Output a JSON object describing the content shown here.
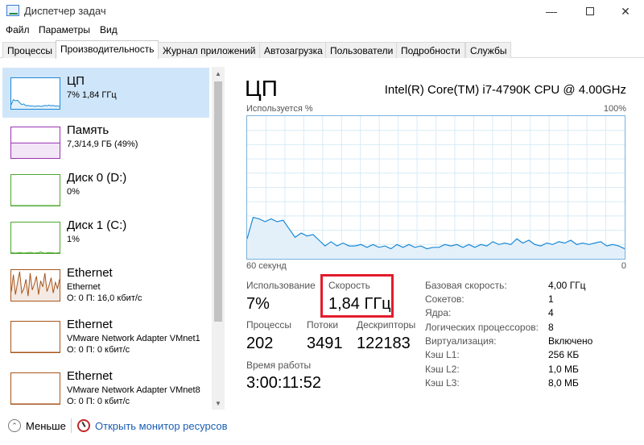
{
  "window": {
    "title": "Диспетчер задач",
    "minimize_glyph": "—",
    "close_glyph": "✕"
  },
  "menu": [
    "Файл",
    "Параметры",
    "Вид"
  ],
  "tabs": [
    "Процессы",
    "Производительность",
    "Журнал приложений",
    "Автозагрузка",
    "Пользователи",
    "Подробности",
    "Службы"
  ],
  "active_tab": "Производительность",
  "sidebar": {
    "items": [
      {
        "name": "ЦП",
        "line1": "7% 1,84 ГГц",
        "line2": "",
        "color": "#1b89d6",
        "selected": true
      },
      {
        "name": "Память",
        "line1": "7,3/14,9 ГБ (49%)",
        "line2": "",
        "color": "#9b33b3",
        "selected": false
      },
      {
        "name": "Диск 0 (D:)",
        "line1": "0%",
        "line2": "",
        "color": "#4ea72e",
        "selected": false
      },
      {
        "name": "Диск 1 (C:)",
        "line1": "1%",
        "line2": "",
        "color": "#4ea72e",
        "selected": false
      },
      {
        "name": "Ethernet",
        "line1": "Ethernet",
        "line2": "О: 0 П: 16,0 кбит/с",
        "color": "#a7551c",
        "selected": false
      },
      {
        "name": "Ethernet",
        "line1": "VMware Network Adapter VMnet1",
        "line2": "О: 0 П: 0 кбит/с",
        "color": "#a7551c",
        "selected": false
      },
      {
        "name": "Ethernet",
        "line1": "VMware Network Adapter VMnet8",
        "line2": "О: 0 П: 0 кбит/с",
        "color": "#a7551c",
        "selected": false
      }
    ]
  },
  "main": {
    "title": "ЦП",
    "model": "Intel(R) Core(TM) i7-4790K CPU @ 4.00GHz",
    "graph": {
      "label_top_left": "Используется %",
      "label_top_right": "100%",
      "label_bottom_left": "60 секунд",
      "label_bottom_right": "0",
      "line_color": "#1b89d6",
      "fill_color": "#e3f0fa",
      "grid_color": "#d7ebf7",
      "y_max": 100,
      "samples": [
        14,
        29,
        28,
        26,
        28,
        26,
        27,
        21,
        15,
        18,
        16,
        17,
        13,
        9,
        12,
        9,
        11,
        9,
        9,
        10,
        8,
        10,
        8,
        9,
        7,
        10,
        8,
        10,
        8,
        9,
        7,
        8,
        8,
        10,
        9,
        10,
        8,
        10,
        8,
        10,
        9,
        12,
        10,
        11,
        10,
        14,
        11,
        13,
        10,
        9,
        11,
        10,
        12,
        11,
        13,
        10,
        11,
        10,
        11,
        12,
        9,
        10,
        9,
        7
      ]
    },
    "stats": {
      "usage_label": "Использование",
      "usage_value": "7%",
      "speed_label": "Скорость",
      "speed_value": "1,84 ГГц",
      "processes_label": "Процессы",
      "processes_value": "202",
      "threads_label": "Потоки",
      "threads_value": "3491",
      "handles_label": "Дескрипторы",
      "handles_value": "122183",
      "uptime_label": "Время работы",
      "uptime_value": "3:00:11:52"
    },
    "specs": [
      {
        "label": "Базовая скорость:",
        "value": "4,00 ГГц"
      },
      {
        "label": "Сокетов:",
        "value": "1"
      },
      {
        "label": "Ядра:",
        "value": "4"
      },
      {
        "label": "Логических процессоров:",
        "value": "8"
      },
      {
        "label": "Виртуализация:",
        "value": "Включено"
      },
      {
        "label": "Кэш L1:",
        "value": "256 КБ"
      },
      {
        "label": "Кэш L2:",
        "value": "1,0 МБ"
      },
      {
        "label": "Кэш L3:",
        "value": "8,0 МБ"
      }
    ]
  },
  "footer": {
    "fewer_label": "Меньше",
    "fewer_glyph": "⌃",
    "monitor_link": "Открыть монитор ресурсов"
  },
  "thumbnails": {
    "cpu": [
      14,
      30,
      26,
      28,
      20,
      14,
      16,
      10,
      11,
      9,
      10,
      8,
      9,
      10,
      8,
      9,
      11,
      10,
      12,
      10,
      11,
      9,
      10,
      8
    ],
    "memory": [
      49,
      49,
      49,
      49,
      49,
      49,
      49,
      49,
      49,
      49,
      49,
      49,
      49,
      49,
      49,
      49,
      49,
      49,
      49,
      49,
      49,
      49,
      49,
      49
    ],
    "disk0": [
      0,
      0,
      0,
      0,
      0,
      0,
      0,
      0,
      0,
      0,
      0,
      0,
      0,
      0,
      0,
      0,
      0,
      0,
      0,
      0,
      0,
      0,
      0,
      0
    ],
    "disk1": [
      1,
      1,
      0,
      1,
      2,
      1,
      0,
      1,
      1,
      3,
      1,
      0,
      1,
      1,
      4,
      1,
      0,
      1,
      2,
      1,
      1,
      0,
      1,
      1
    ],
    "eth0": [
      30,
      85,
      20,
      60,
      95,
      25,
      40,
      70,
      15,
      90,
      35,
      55,
      80,
      20,
      65,
      45,
      90,
      30,
      50,
      75,
      25,
      60,
      40,
      70
    ],
    "eth1": [
      0,
      0,
      0,
      0,
      0,
      0,
      0,
      0,
      0,
      0,
      0,
      0,
      0,
      0,
      0,
      0,
      0,
      0,
      0,
      0,
      0,
      0,
      0,
      0
    ],
    "eth2": [
      0,
      0,
      0,
      0,
      0,
      0,
      0,
      0,
      0,
      0,
      0,
      0,
      0,
      0,
      0,
      0,
      0,
      0,
      0,
      0,
      0,
      0,
      0,
      0
    ]
  }
}
